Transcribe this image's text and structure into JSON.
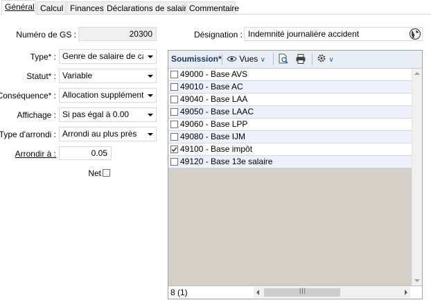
{
  "tabs": [
    {
      "label": "Général",
      "active": true
    },
    {
      "label": "Calcul",
      "active": false
    },
    {
      "label": "Finances",
      "active": false
    },
    {
      "label": "Déclarations de salaire",
      "active": false
    },
    {
      "label": "Commentaire",
      "active": false
    }
  ],
  "form": {
    "numero_label": "Numéro de GS :",
    "numero_value": "20300",
    "type_label": "Type* :",
    "type_value": "Genre de salaire de calc",
    "statut_label": "Statut* :",
    "statut_value": "Variable",
    "consequence_label": "Conséquence* :",
    "consequence_value": "Allocation supplémentair",
    "affichage_label": "Affichage :",
    "affichage_value": "Si pas égal à 0.00",
    "arrondi_type_label": "Type d'arrondi :",
    "arrondi_type_value": "Arrondi au plus près",
    "arrondir_label": "Arrondir à :",
    "arrondir_value": "0.05",
    "net_label": "Net",
    "net_checked": false,
    "designation_label": "Désignation :",
    "designation_value": "Indemnité journalière accident"
  },
  "panel": {
    "title": "Soumission*",
    "vues_label": "Vues",
    "status": "8 (1)",
    "items": [
      {
        "label": "49000 - Base AVS",
        "checked": false
      },
      {
        "label": "49010 - Base AC",
        "checked": false
      },
      {
        "label": "49040 - Base LAA",
        "checked": false
      },
      {
        "label": "49050 - Base LAAC",
        "checked": false
      },
      {
        "label": "49060 - Base LPP",
        "checked": false
      },
      {
        "label": "49080 - Base IJM",
        "checked": false
      },
      {
        "label": "49100 - Base impôt",
        "checked": true
      },
      {
        "label": "49120 - Base 13e salaire",
        "checked": false
      }
    ]
  },
  "colors": {
    "accent": "#1f5fa8",
    "title": "#1f3864",
    "list_alt_row": "#eef1fb",
    "panel_background": "#d4d0c8"
  }
}
